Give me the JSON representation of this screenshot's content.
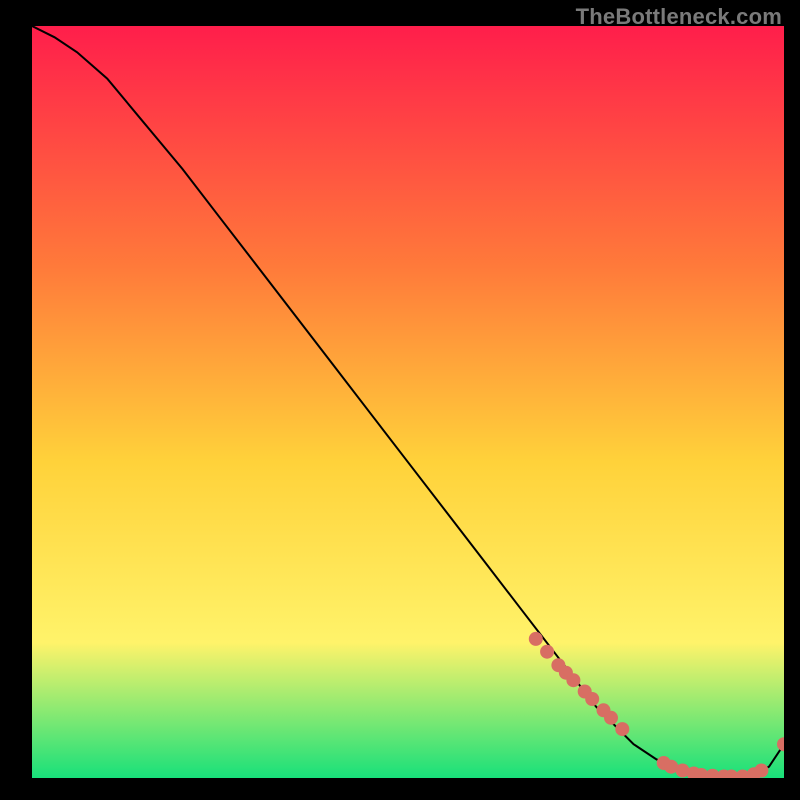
{
  "watermark": "TheBottleneck.com",
  "colors": {
    "gradient_top": "#ff1e4b",
    "gradient_mid1": "#ff7a3a",
    "gradient_mid2": "#ffd23a",
    "gradient_mid3": "#fff36a",
    "gradient_bottom": "#18e07a",
    "curve": "#000000",
    "marker": "#d86e63",
    "frame_bg": "#000000"
  },
  "chart_data": {
    "type": "line",
    "title": "",
    "xlabel": "",
    "ylabel": "",
    "xlim": [
      0,
      100
    ],
    "ylim": [
      0,
      100
    ],
    "series": [
      {
        "name": "bottleneck-curve",
        "x": [
          0,
          3,
          6,
          10,
          15,
          20,
          25,
          30,
          35,
          40,
          45,
          50,
          55,
          60,
          65,
          70,
          75,
          80,
          83,
          85,
          88,
          90,
          92,
          94,
          96,
          98,
          100
        ],
        "y": [
          100,
          98.5,
          96.5,
          93,
          87,
          81,
          74.5,
          68,
          61.5,
          55,
          48.5,
          42,
          35.5,
          29,
          22.5,
          16,
          9.5,
          4.5,
          2.5,
          1.5,
          0.6,
          0.3,
          0.2,
          0.2,
          0.5,
          1.5,
          4.5
        ]
      }
    ],
    "markers": {
      "name": "highlighted-points",
      "x": [
        67,
        68.5,
        70,
        71,
        72,
        73.5,
        74.5,
        76,
        77,
        78.5,
        84,
        85,
        86.5,
        88,
        89,
        90.5,
        92,
        93,
        94.5,
        96,
        97,
        100
      ],
      "y": [
        18.5,
        16.8,
        15,
        14,
        13,
        11.5,
        10.5,
        9,
        8,
        6.5,
        2,
        1.5,
        1,
        0.6,
        0.4,
        0.3,
        0.2,
        0.2,
        0.2,
        0.5,
        1,
        4.5
      ]
    }
  }
}
